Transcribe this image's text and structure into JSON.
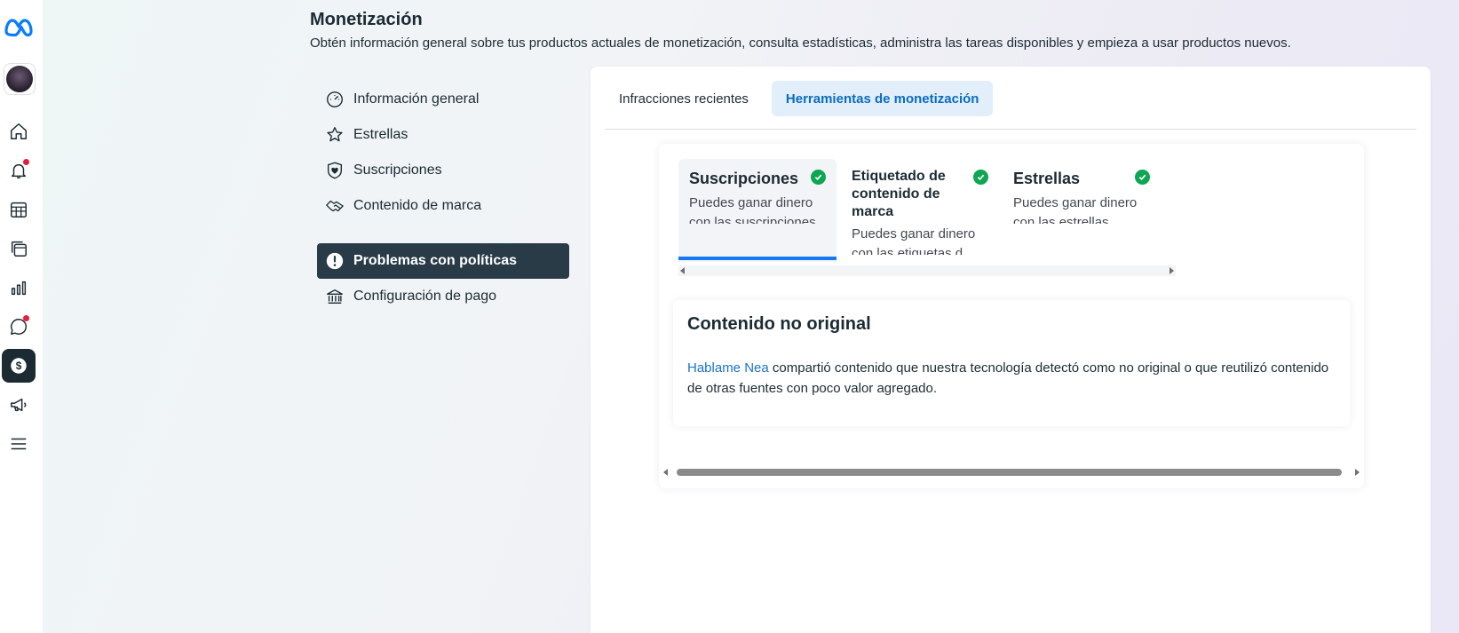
{
  "rail": {
    "logo": "meta-logo",
    "items": [
      {
        "icon": "home-icon"
      },
      {
        "icon": "bell-icon",
        "badge": true
      },
      {
        "icon": "calendar-grid-icon"
      },
      {
        "icon": "stacked-pages-icon"
      },
      {
        "icon": "bar-chart-icon"
      },
      {
        "icon": "chat-bubble-icon",
        "badge": true
      },
      {
        "icon": "dollar-icon",
        "active": true
      },
      {
        "icon": "megaphone-icon"
      },
      {
        "icon": "menu-icon"
      }
    ],
    "accent": "#1c2b33",
    "badge_color": "#e41e3f"
  },
  "header": {
    "title": "Monetización",
    "description": "Obtén información general sobre tus productos actuales de monetización, consulta estadísticas, administra las tareas disponibles y empieza a usar productos nuevos."
  },
  "menu": {
    "items": [
      {
        "label": "Información general",
        "icon": "gauge-icon"
      },
      {
        "label": "Estrellas",
        "icon": "star-icon"
      },
      {
        "label": "Suscripciones",
        "icon": "heart-badge-icon"
      },
      {
        "label": "Contenido de marca",
        "icon": "handshake-icon"
      }
    ],
    "items2": [
      {
        "label": "Problemas con políticas",
        "icon": "alert-icon",
        "active": true
      },
      {
        "label": "Configuración de pago",
        "icon": "bank-icon"
      }
    ]
  },
  "tabs": [
    {
      "label": "Infracciones recientes",
      "selected": false
    },
    {
      "label": "Herramientas de monetización",
      "selected": true
    }
  ],
  "products": [
    {
      "title": "Suscripciones",
      "desc": "Puedes ganar dinero con las suscripciones",
      "status": "check-icon",
      "selected": true
    },
    {
      "title": "Etiquetado de contenido de marca",
      "desc": "Puedes ganar dinero con las etiquetas d",
      "status": "check-icon",
      "selected": false
    },
    {
      "title": "Estrellas",
      "desc": "Puedes ganar dinero con las estrellas",
      "status": "check-icon",
      "selected": false
    }
  ],
  "violation": {
    "title": "Contenido no original",
    "page_name": "Hablame Nea",
    "text": " compartió contenido que nuestra tecnología detectó como no original o que reutilizó contenido de otras fuentes con poco valor agregado."
  },
  "colors": {
    "link": "#1a73c5",
    "tab_selected_bg": "#e2eefa",
    "tab_selected_text": "#0a6cc0",
    "underline": "#1877f2",
    "check": "#0ea653"
  }
}
